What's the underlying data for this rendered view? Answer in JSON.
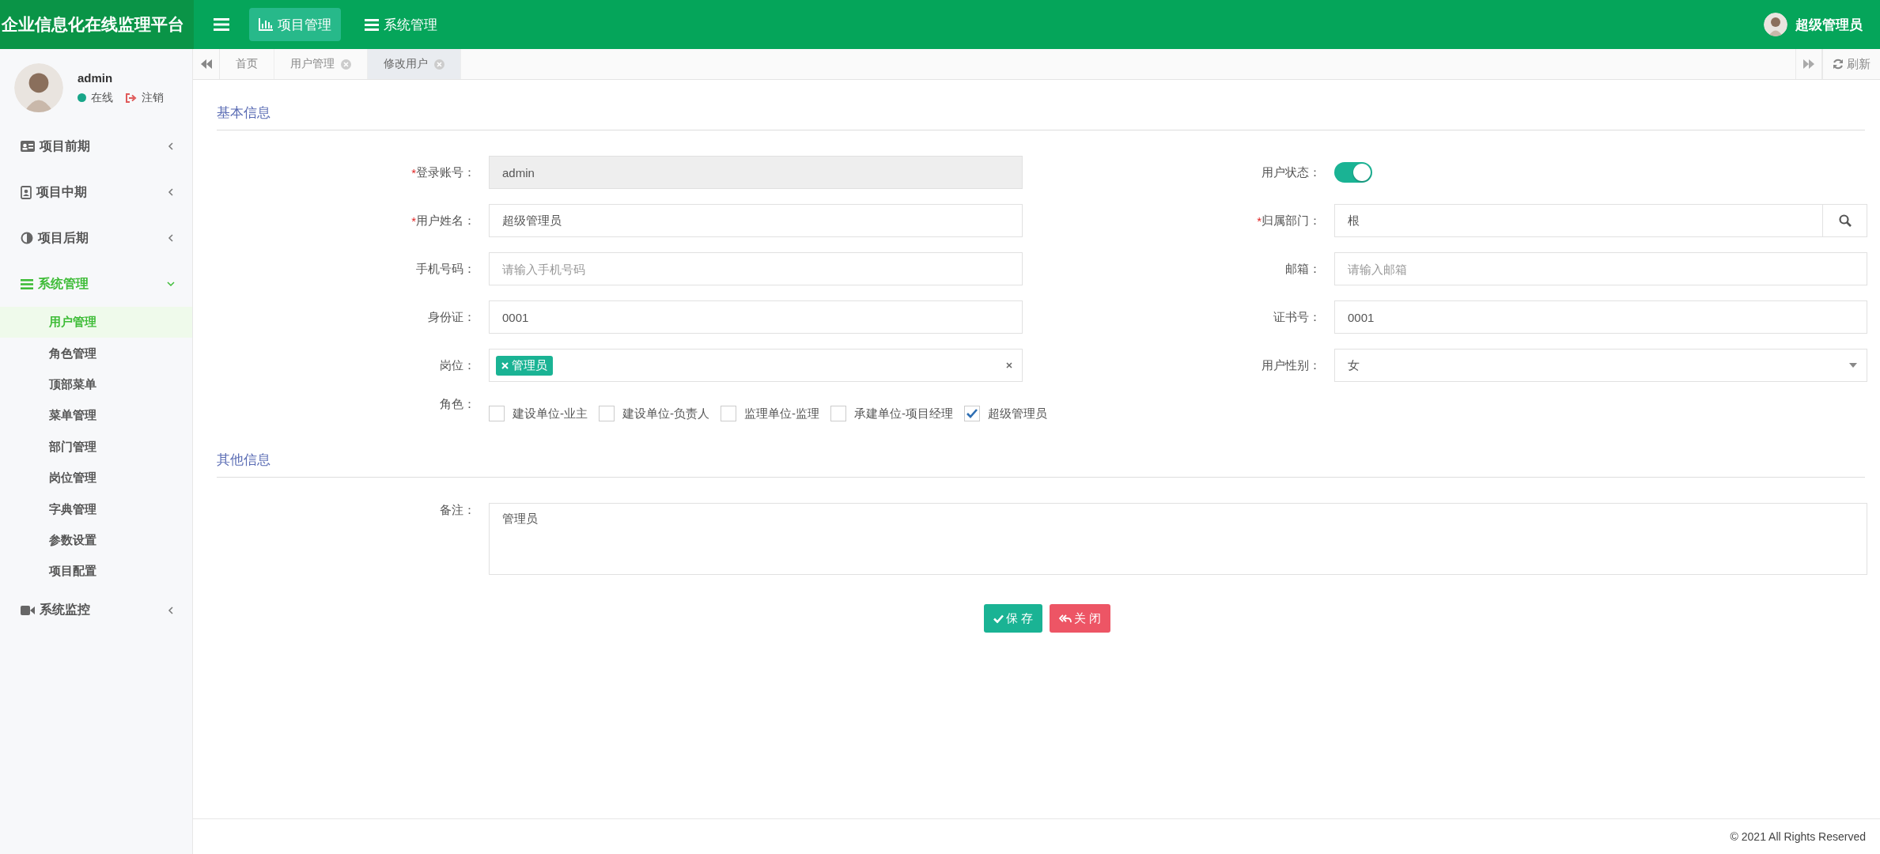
{
  "brand": "企业信息化在线监理平台",
  "top_nav": [
    {
      "label": "项目管理",
      "selected": true
    },
    {
      "label": "系统管理",
      "selected": false
    }
  ],
  "header_user": {
    "name": "超级管理员"
  },
  "sidebar": {
    "user": {
      "name": "admin",
      "online": true,
      "status": "在线",
      "logout": "注销"
    },
    "items": [
      {
        "label": "项目前期",
        "expanded": false,
        "selected": false
      },
      {
        "label": "项目中期",
        "expanded": false,
        "selected": false
      },
      {
        "label": "项目后期",
        "expanded": false,
        "selected": false
      },
      {
        "label": "系统管理",
        "expanded": true,
        "selected": true,
        "children": [
          {
            "label": "用户管理",
            "selected": true
          },
          {
            "label": "角色管理",
            "selected": false
          },
          {
            "label": "顶部菜单",
            "selected": false
          },
          {
            "label": "菜单管理",
            "selected": false
          },
          {
            "label": "部门管理",
            "selected": false
          },
          {
            "label": "岗位管理",
            "selected": false
          },
          {
            "label": "字典管理",
            "selected": false
          },
          {
            "label": "参数设置",
            "selected": false
          },
          {
            "label": "项目配置",
            "selected": false
          }
        ]
      },
      {
        "label": "系统监控",
        "expanded": false,
        "selected": false
      }
    ]
  },
  "tabs": [
    {
      "label": "首页",
      "closable": false,
      "selected": false
    },
    {
      "label": "用户管理",
      "closable": true,
      "selected": false
    },
    {
      "label": "修改用户",
      "closable": true,
      "selected": true
    }
  ],
  "refresh": "刷新",
  "sections": [
    {
      "title": "基本信息",
      "fields": [
        {
          "label": "登录账号：",
          "required_mark": "*",
          "kind": "text",
          "value": "admin",
          "disabled": true
        },
        {
          "label": "用户状态：",
          "kind": "switch",
          "on": true
        },
        {
          "label": "用户姓名：",
          "required_mark": "*",
          "kind": "text",
          "value": "超级管理员",
          "disabled": false
        },
        {
          "label": "归属部门：",
          "required_mark": "*",
          "kind": "search",
          "value": "根"
        },
        {
          "label": "手机号码：",
          "kind": "text",
          "placeholder": "请输入手机号码",
          "disabled": false
        },
        {
          "label": "邮箱：",
          "kind": "text",
          "placeholder": "请输入邮箱",
          "disabled": false
        },
        {
          "label": "身份证：",
          "kind": "text",
          "value": "0001",
          "disabled": false
        },
        {
          "label": "证书号：",
          "kind": "text",
          "value": "0001",
          "disabled": false
        },
        {
          "label": "岗位：",
          "kind": "tags",
          "tags": [
            "管理员"
          ]
        },
        {
          "label": "用户性别：",
          "kind": "select",
          "value": "女"
        },
        {
          "label": "角色：",
          "kind": "checkboxes",
          "options": [
            {
              "label": "建设单位-业主",
              "checked": false
            },
            {
              "label": "建设单位-负责人",
              "checked": false
            },
            {
              "label": "监理单位-监理",
              "checked": false
            },
            {
              "label": "承建单位-项目经理",
              "checked": false
            },
            {
              "label": "超级管理员",
              "checked": true
            }
          ]
        }
      ]
    },
    {
      "title": "其他信息",
      "fields": [
        {
          "label": "备注：",
          "kind": "textarea",
          "value": "管理员"
        }
      ]
    }
  ],
  "buttons": [
    {
      "label": "保 存",
      "kind": "save"
    },
    {
      "label": "关 闭",
      "kind": "close"
    }
  ],
  "footer": "© 2021 All Rights Reserved"
}
